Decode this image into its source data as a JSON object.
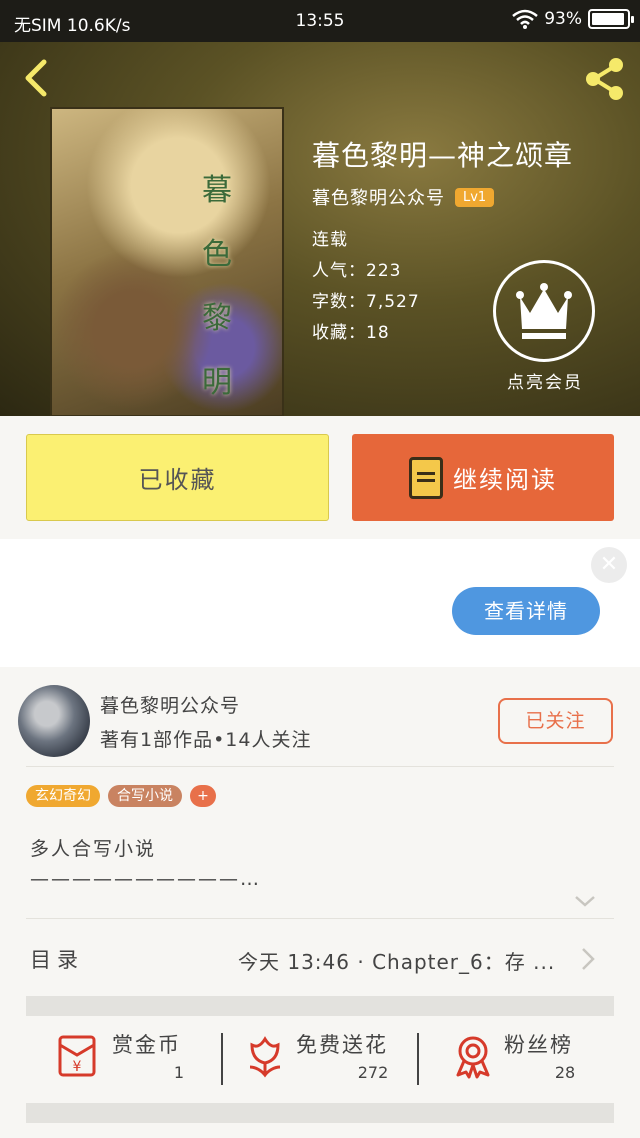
{
  "status_bar": {
    "carrier": "无SIM 10.6K/s",
    "time": "13:55",
    "battery": "93%",
    "battery_level": 0.93
  },
  "book": {
    "title": "暮色黎明—神之颂章",
    "author": "暮色黎明公众号",
    "level": "Lv1",
    "cover_title_chars": [
      "暮",
      "色",
      "黎",
      "明"
    ],
    "status": "连载",
    "popularity": "人气：223",
    "word_count": "字数：7,527",
    "favorites": "收藏：18"
  },
  "vip": {
    "label": "点亮会员"
  },
  "actions": {
    "favorited_label": "已收藏",
    "continue_label": "继续阅读"
  },
  "ad": {
    "close_glyph": "✕",
    "detail_label": "查看详情"
  },
  "author_card": {
    "name": "暮色黎明公众号",
    "stats": "著有1部作品•14人关注",
    "follow_label": "已关注"
  },
  "tags": [
    "玄幻奇幻",
    "合写小说"
  ],
  "tag_add": "+",
  "description": {
    "line1": "多人合写小说",
    "line2": "——————————…"
  },
  "toc": {
    "label": "目录",
    "latest": "今天 13:46 · Chapter_6：存 ..."
  },
  "stats": {
    "reward": {
      "label": "赏金币",
      "value": "1"
    },
    "flowers": {
      "label": "免费送花",
      "value": "272"
    },
    "fans": {
      "label": "粉丝榜",
      "value": "28"
    }
  },
  "colors": {
    "accent_orange": "#e6673a",
    "favorite_yellow": "#fbf072",
    "tag_orange": "#f0a830",
    "ad_button_blue": "#4f97e0"
  },
  "icons": [
    "back-icon",
    "share-icon",
    "crown-icon",
    "book-icon",
    "chevron-down-icon",
    "chevron-right-icon",
    "red-envelope-icon",
    "flower-icon",
    "medal-icon"
  ]
}
